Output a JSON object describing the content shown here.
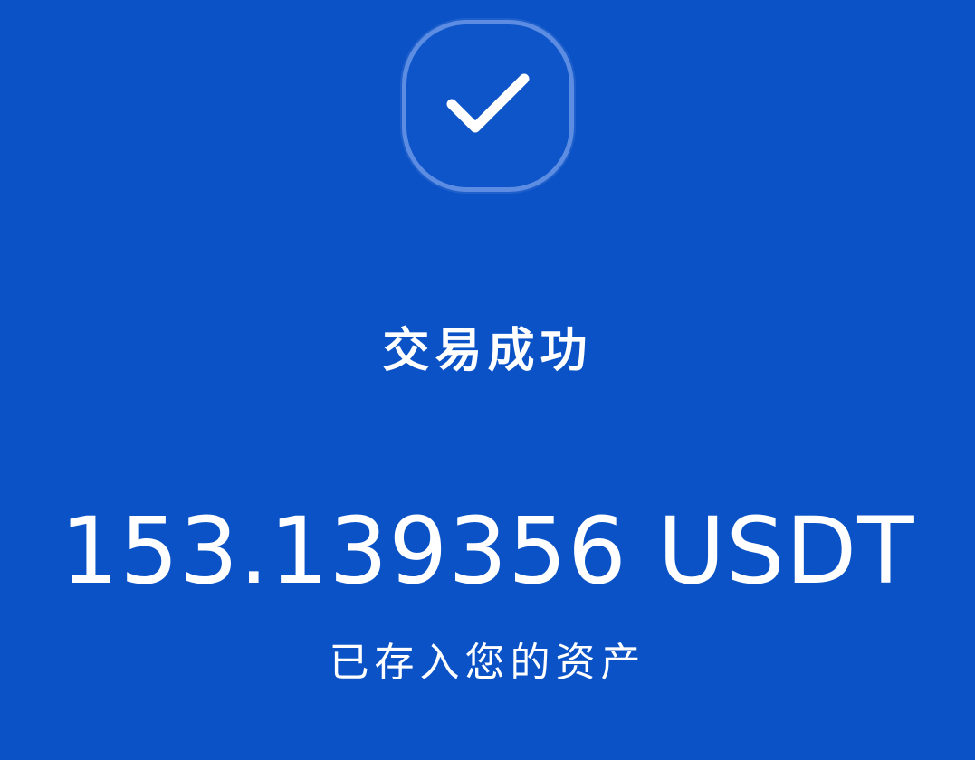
{
  "status": {
    "icon": "checkmark-icon",
    "title": "交易成功"
  },
  "transaction": {
    "amount": "153.139356 USDT",
    "note": "已存入您的资产"
  },
  "colors": {
    "background": "#0a52c6",
    "badge_border": "#78a0eb",
    "text": "#ffffff"
  }
}
